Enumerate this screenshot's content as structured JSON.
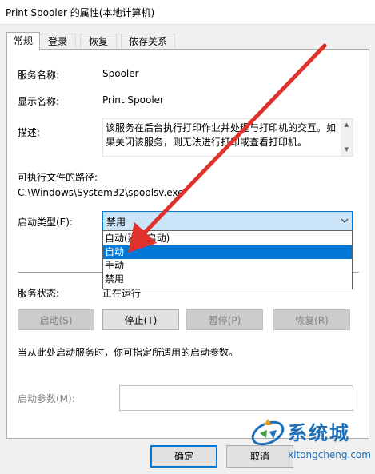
{
  "window": {
    "title": "Print Spooler 的属性(本地计算机)"
  },
  "tabs": [
    {
      "label": "常规",
      "active": true
    },
    {
      "label": "登录"
    },
    {
      "label": "恢复"
    },
    {
      "label": "依存关系"
    }
  ],
  "general": {
    "service_name_label": "服务名称:",
    "service_name_value": "Spooler",
    "display_name_label": "显示名称:",
    "display_name_value": "Print Spooler",
    "description_label": "描述:",
    "description_line1": "该服务在后台执行打印作业并处理与打印机的交互。如",
    "description_line2": "果关闭该服务，则无法进行打印或查看打印机。",
    "exe_path_label": "可执行文件的路径:",
    "exe_path_value": "C:\\Windows\\System32\\spoolsv.exe",
    "startup_type_label": "启动类型(E):",
    "startup_type_value": "禁用",
    "startup_options": [
      "自动(延迟启动)",
      "自动",
      "手动",
      "禁用"
    ],
    "startup_selected_index": 1,
    "status_label": "服务状态:",
    "status_value": "正在运行",
    "buttons": {
      "start": "启动(S)",
      "stop": "停止(T)",
      "pause": "暂停(P)",
      "resume": "恢复(R)"
    },
    "hint": "当从此处启动服务时，你可指定所适用的启动参数。",
    "params_label": "启动参数(M):",
    "params_value": ""
  },
  "footer": {
    "ok": "确定",
    "cancel": "取消"
  },
  "watermark": {
    "name": "系统城",
    "url": "xitongcheng.com"
  },
  "colors": {
    "accent": "#0078d7",
    "annotation_arrow": "#e0322c"
  }
}
